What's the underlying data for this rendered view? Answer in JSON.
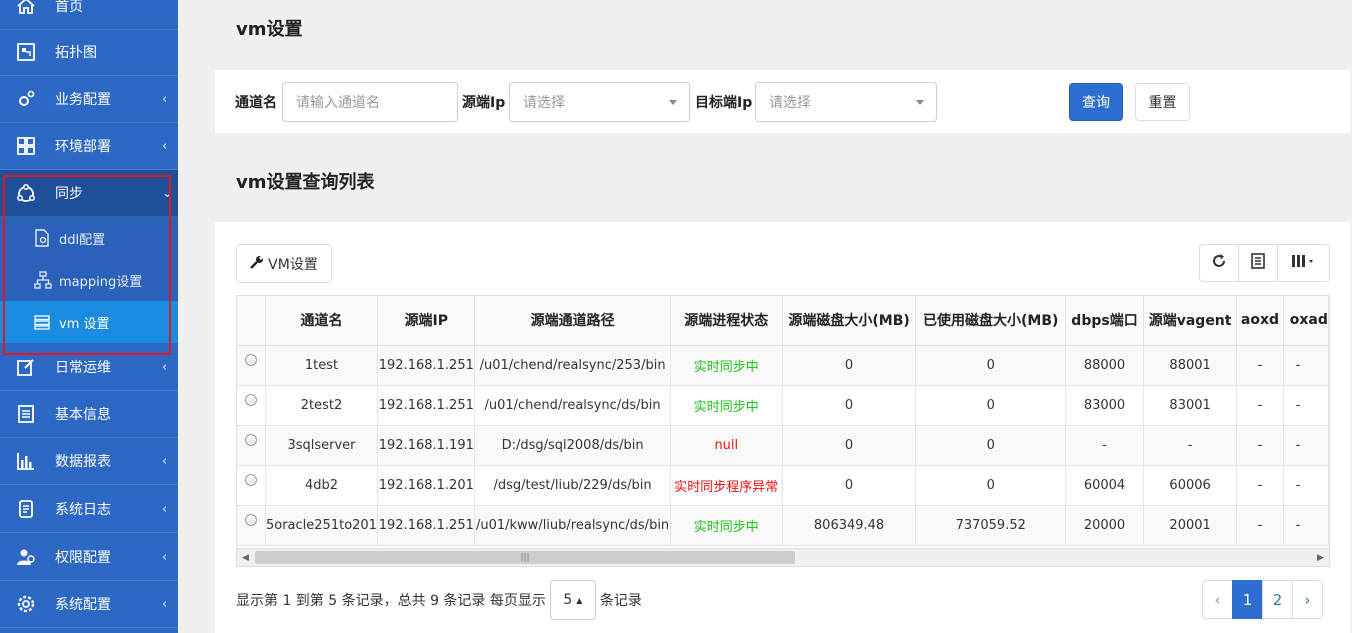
{
  "sidebar": {
    "items": [
      {
        "label": "首页",
        "icon": "home-icon"
      },
      {
        "label": "拓扑图",
        "icon": "topology-icon"
      },
      {
        "label": "业务配置",
        "icon": "gears-icon"
      },
      {
        "label": "环境部署",
        "icon": "grid-icon"
      },
      {
        "label": "同步",
        "icon": "sync-icon"
      },
      {
        "label": "日常运维",
        "icon": "edit-icon"
      },
      {
        "label": "基本信息",
        "icon": "document-icon"
      },
      {
        "label": "数据报表",
        "icon": "bar-chart-icon"
      },
      {
        "label": "系统日志",
        "icon": "log-icon"
      },
      {
        "label": "权限配置",
        "icon": "users-icon"
      },
      {
        "label": "系统配置",
        "icon": "settings-icon"
      }
    ],
    "sync_sub": [
      {
        "label": "ddl配置"
      },
      {
        "label": "mapping设置"
      },
      {
        "label": "vm 设置"
      }
    ]
  },
  "page": {
    "title": "vm设置",
    "list_title": "vm设置查询列表"
  },
  "filter": {
    "channel_label": "通道名",
    "channel_placeholder": "请输入通道名",
    "source_ip_label": "源端Ip",
    "source_ip_placeholder": "请选择",
    "target_ip_label": "目标端Ip",
    "target_ip_placeholder": "请选择",
    "query_button": "查询",
    "reset_button": "重置"
  },
  "toolbar": {
    "vm_button": "VM设置"
  },
  "table": {
    "columns": [
      "通道名",
      "源端IP",
      "源端通道路径",
      "源端进程状态",
      "源端磁盘大小(MB)",
      "已使用磁盘大小(MB)",
      "dbps端口",
      "源端vagent",
      "aoxd",
      "oxad"
    ],
    "rows": [
      {
        "name": "1test",
        "ip": "192.168.1.251",
        "path": "/u01/chend/realsync/253/bin",
        "status": "实时同步中",
        "status_color": "#18c418",
        "disk": "0",
        "used": "0",
        "dbps": "88000",
        "vagent": "88001",
        "aoxd": "-",
        "oxad": "-"
      },
      {
        "name": "2test2",
        "ip": "192.168.1.251",
        "path": "/u01/chend/realsync/ds/bin",
        "status": "实时同步中",
        "status_color": "#18c418",
        "disk": "0",
        "used": "0",
        "dbps": "83000",
        "vagent": "83001",
        "aoxd": "-",
        "oxad": "-"
      },
      {
        "name": "3sqlserver",
        "ip": "192.168.1.191",
        "path": "D:/dsg/sql2008/ds/bin",
        "status": "null",
        "status_color": "#ee1111",
        "disk": "0",
        "used": "0",
        "dbps": "-",
        "vagent": "-",
        "aoxd": "-",
        "oxad": "-"
      },
      {
        "name": "4db2",
        "ip": "192.168.1.201",
        "path": "/dsg/test/liub/229/ds/bin",
        "status": "实时同步程序异常",
        "status_color": "#ee1111",
        "disk": "0",
        "used": "0",
        "dbps": "60004",
        "vagent": "60006",
        "aoxd": "-",
        "oxad": "-"
      },
      {
        "name": "5oracle251to201",
        "ip": "192.168.1.251",
        "path": "/u01/kww/liub/realsync/ds/bin",
        "status": "实时同步中",
        "status_color": "#18c418",
        "disk": "806349.48",
        "used": "737059.52",
        "dbps": "20000",
        "vagent": "20001",
        "aoxd": "-",
        "oxad": "-"
      }
    ]
  },
  "pagination": {
    "summary_prefix": "显示第 1 到第 5 条记录，总共 9 条记录 每页显示",
    "page_size": "5",
    "summary_suffix": "条记录",
    "prev": "‹",
    "pages": [
      "1",
      "2"
    ],
    "next": "›"
  },
  "colors": {
    "sidebar_bg": "#2d68c4",
    "sidebar_active": "#1a8be0",
    "primary": "#2d6fd0",
    "status_ok": "#18c418",
    "status_error": "#ee1111",
    "highlight_box": "#e0181f"
  }
}
